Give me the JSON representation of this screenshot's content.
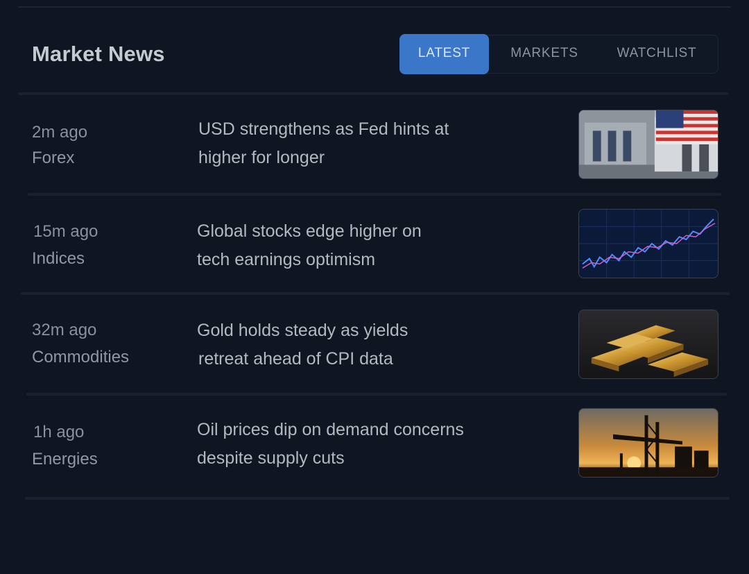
{
  "header": {
    "title": "Market News"
  },
  "tabs": [
    {
      "label": "LATEST",
      "active": true
    },
    {
      "label": "MARKETS",
      "active": false
    },
    {
      "label": "WATCHLIST",
      "active": false
    }
  ],
  "news": [
    {
      "time": "2m ago",
      "category": "Forex",
      "headline_line1": "USD strengthens as Fed hints at",
      "headline_line2": "higher for longer",
      "thumbnail": "us-flag-building-icon"
    },
    {
      "time": "15m ago",
      "category": "Indices",
      "headline_line1": "Global stocks edge higher on",
      "headline_line2": "tech earnings optimism",
      "thumbnail": "stock-chart-icon"
    },
    {
      "time": "32m ago",
      "category": "Commodities",
      "headline_line1": "Gold holds steady as yields",
      "headline_line2": "retreat ahead of CPI data",
      "thumbnail": "gold-bars-icon"
    },
    {
      "time": "1h ago",
      "category": "Energies",
      "headline_line1": "Oil prices dip on demand concerns",
      "headline_line2": "despite supply cuts",
      "thumbnail": "oil-rig-icon"
    }
  ],
  "colors": {
    "background": "#0f1521",
    "accent": "#3b77c8",
    "divider": "#1a2130"
  }
}
